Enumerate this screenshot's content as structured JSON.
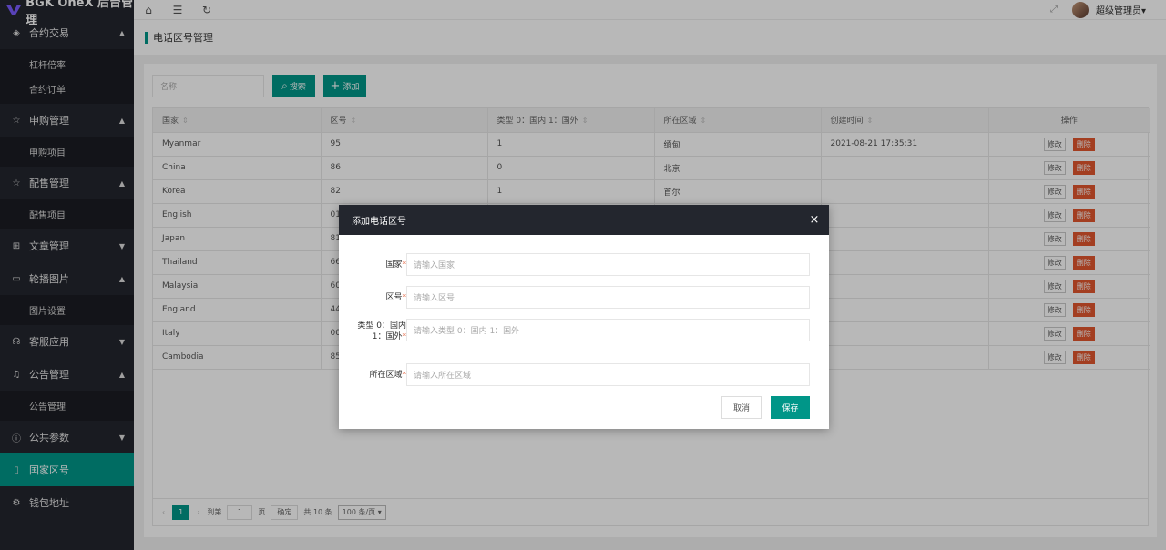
{
  "app": {
    "logo_text": "BGK OneX 后台管理"
  },
  "sidebar": {
    "groups": [
      {
        "icon": "◈",
        "label": "合约交易",
        "arrow": "▲",
        "items": [
          "杠杆倍率",
          "合约订单"
        ]
      },
      {
        "icon": "☆",
        "label": "申购管理",
        "arrow": "▲",
        "items": [
          "申购项目"
        ]
      },
      {
        "icon": "☆",
        "label": "配售管理",
        "arrow": "▲",
        "items": [
          "配售项目"
        ]
      },
      {
        "icon": "⊞",
        "label": "文章管理",
        "arrow": "▼",
        "items": []
      },
      {
        "icon": "▭",
        "label": "轮播图片",
        "arrow": "▲",
        "items": [
          "图片设置"
        ]
      },
      {
        "icon": "☊",
        "label": "客服应用",
        "arrow": "▼",
        "items": []
      },
      {
        "icon": "♫",
        "label": "公告管理",
        "arrow": "▲",
        "items": [
          "公告管理"
        ]
      },
      {
        "icon": "ⓘ",
        "label": "公共参数",
        "arrow": "▼",
        "items": []
      },
      {
        "icon": "▯",
        "label": "国家区号",
        "arrow": "",
        "items": []
      },
      {
        "icon": "⚙",
        "label": "钱包地址",
        "arrow": "",
        "items": []
      }
    ]
  },
  "header": {
    "home_icon": "⌂",
    "menu_icon": "☰",
    "refresh_icon": "↻",
    "fullscreen_icon": "⤢",
    "user_name": "超级管理员▾"
  },
  "page": {
    "title": "电话区号管理"
  },
  "toolbar": {
    "search_placeholder": "名称",
    "search_label": "搜索",
    "search_icon": "⌕",
    "add_label": "添加",
    "add_icon": "+"
  },
  "table": {
    "columns": [
      "国家",
      "区号",
      "类型 0：国内 1：国外",
      "所在区域",
      "创建时间",
      "操作"
    ],
    "rows": [
      [
        "Myanmar",
        "95",
        "1",
        "缅甸",
        "2021-08-21 17:35:31"
      ],
      [
        "China",
        "86",
        "0",
        "北京",
        ""
      ],
      [
        "Korea",
        "82",
        "1",
        "首尔",
        ""
      ],
      [
        "English",
        "01",
        "",
        "",
        ""
      ],
      [
        "Japan",
        "81",
        "",
        "",
        ""
      ],
      [
        "Thailand",
        "66",
        "",
        "",
        ""
      ],
      [
        "Malaysia",
        "60",
        "",
        "",
        ""
      ],
      [
        "England",
        "44",
        "",
        "",
        ""
      ],
      [
        "Italy",
        "00",
        "",
        "",
        ""
      ],
      [
        "Cambodia",
        "85",
        "",
        "",
        ""
      ]
    ],
    "edit_label": "修改",
    "delete_label": "删除"
  },
  "pager": {
    "prev": "‹",
    "next": "›",
    "current": "1",
    "goto_label": "到第",
    "goto_value": "1",
    "page_unit": "页",
    "confirm_label": "确定",
    "total": "共 10 条",
    "page_size": "100 条/页 ▾"
  },
  "modal": {
    "title": "添加电话区号",
    "close": "×",
    "fields": [
      {
        "label": "国家",
        "placeholder": "请输入国家"
      },
      {
        "label": "区号",
        "placeholder": "请输入区号"
      },
      {
        "label": "类型 0：国内 1：国外",
        "placeholder": "请输入类型 0：国内 1：国外"
      },
      {
        "label": "所在区域",
        "placeholder": "请输入所在区域"
      }
    ],
    "required_mark": "*",
    "cancel_label": "取消",
    "save_label": "保存"
  },
  "colors": {
    "accent": "#009688",
    "sidebar": "#23262e",
    "danger": "#e2572f"
  }
}
